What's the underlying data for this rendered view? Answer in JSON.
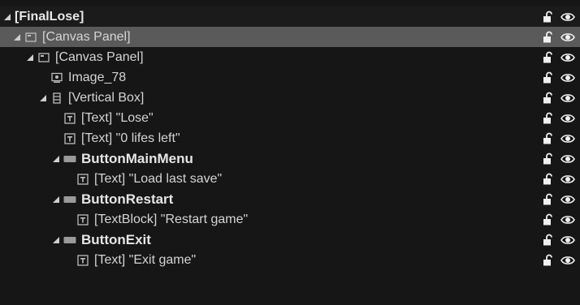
{
  "root": {
    "label": "[FinalLose]"
  },
  "rows": [
    {
      "label": "[Canvas Panel]",
      "indent": 1,
      "icon": "canvas-panel-icon",
      "expanded": true,
      "bold": false,
      "selected": true
    },
    {
      "label": "[Canvas Panel]",
      "indent": 2,
      "icon": "canvas-panel-icon",
      "expanded": true,
      "bold": false,
      "selected": false
    },
    {
      "label": "Image_78",
      "indent": 3,
      "icon": "image-icon",
      "expanded": null,
      "bold": false,
      "selected": false
    },
    {
      "label": "[Vertical Box]",
      "indent": 3,
      "icon": "vertical-box-icon",
      "expanded": true,
      "bold": false,
      "selected": false
    },
    {
      "label": "[Text] \"Lose\"",
      "indent": 4,
      "icon": "text-icon",
      "expanded": null,
      "bold": false,
      "selected": false
    },
    {
      "label": "[Text] \"0 lifes left\"",
      "indent": 4,
      "icon": "text-icon",
      "expanded": null,
      "bold": false,
      "selected": false
    },
    {
      "label": "ButtonMainMenu",
      "indent": 4,
      "icon": "button-icon",
      "expanded": true,
      "bold": true,
      "selected": false
    },
    {
      "label": "[Text] \"Load last save\"",
      "indent": 5,
      "icon": "text-icon",
      "expanded": null,
      "bold": false,
      "selected": false
    },
    {
      "label": "ButtonRestart",
      "indent": 4,
      "icon": "button-icon",
      "expanded": true,
      "bold": true,
      "selected": false
    },
    {
      "label": "[TextBlock] \"Restart game\"",
      "indent": 5,
      "icon": "text-icon",
      "expanded": null,
      "bold": false,
      "selected": false
    },
    {
      "label": "ButtonExit",
      "indent": 4,
      "icon": "button-icon",
      "expanded": true,
      "bold": true,
      "selected": false
    },
    {
      "label": "[Text] \"Exit game\"",
      "indent": 5,
      "icon": "text-icon",
      "expanded": null,
      "bold": false,
      "selected": false
    }
  ],
  "row_controls": [
    "lock-open-icon",
    "eye-visible-icon"
  ]
}
